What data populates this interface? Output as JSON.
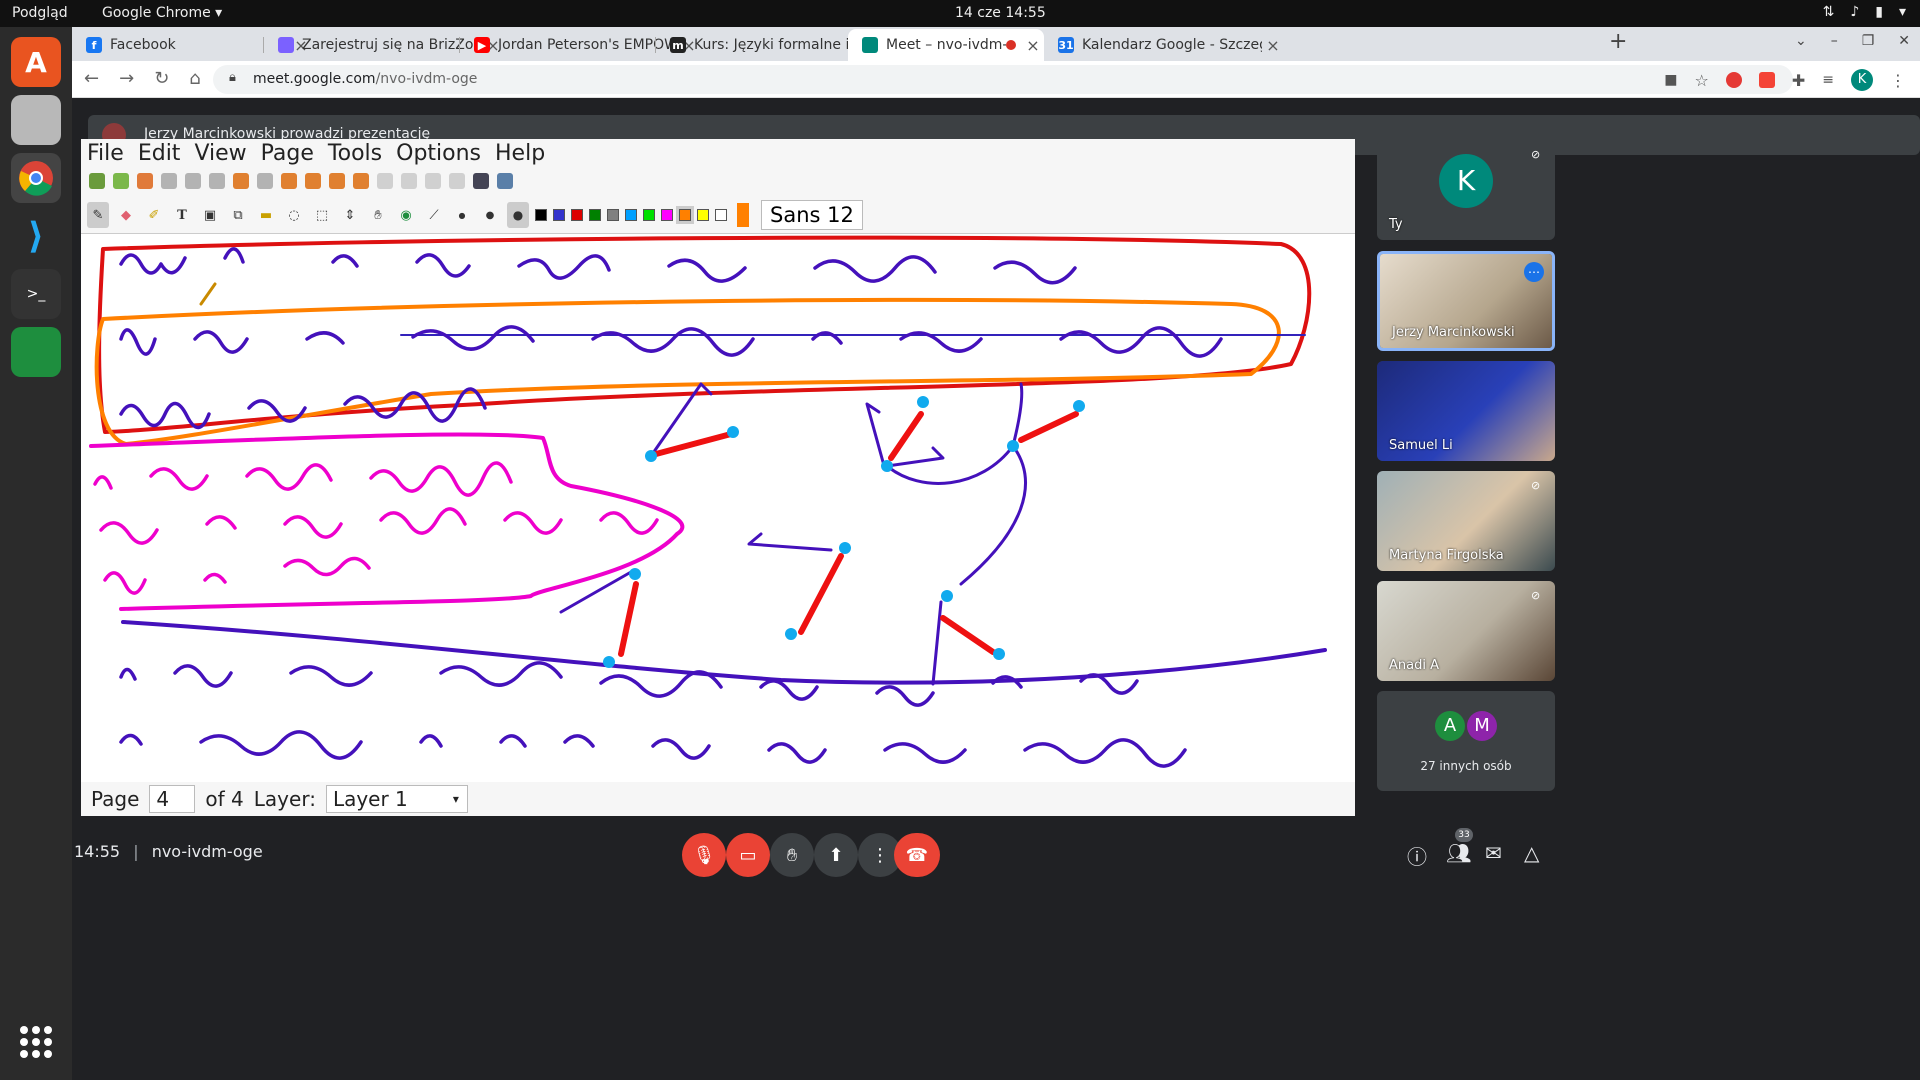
{
  "os": {
    "activities": "Podgląd",
    "app_name": "Google Chrome",
    "clock": "14 cze  14:55"
  },
  "browser": {
    "tabs": [
      {
        "title": "Facebook",
        "favicon_color": "#1877f2",
        "active": false
      },
      {
        "title": "Zarejestruj się na BrizZon",
        "favicon_color": "#7b61ff",
        "active": false
      },
      {
        "title": "Jordan Peterson's EMPOW",
        "favicon_color": "#ff0000",
        "active": false
      },
      {
        "title": "Kurs: Języki formalne i zło",
        "favicon_color": "#222222",
        "active": false
      },
      {
        "title": "Meet – nvo-ivdm-oge",
        "favicon_color": "#00897b",
        "active": true
      },
      {
        "title": "Kalendarz Google - Szczeg",
        "favicon_color": "#1a73e8",
        "active": false
      }
    ],
    "url_host": "meet.google.com",
    "url_path": "/nvo-ivdm-oge",
    "profile_initial": "K"
  },
  "meet": {
    "banner_text": "Jerzy Marcinkowski prowadzi prezentację",
    "meeting_code": "nvo-ivdm-oge",
    "time": "14:55",
    "separator": "|",
    "participants_count": "33",
    "others_label": "27 innych osób",
    "others_initials": [
      "A",
      "M"
    ],
    "tiles": [
      {
        "name": "Ty",
        "initial": "K",
        "type": "avatar"
      },
      {
        "name": "Jerzy Marcinkowski",
        "type": "video",
        "active": true
      },
      {
        "name": "Samuel Li",
        "type": "video"
      },
      {
        "name": "Martyna Firgolska",
        "type": "video"
      },
      {
        "name": "Anadi A",
        "type": "video"
      }
    ]
  },
  "xournal": {
    "menu": [
      "File",
      "Edit",
      "View",
      "Page",
      "Tools",
      "Options",
      "Help"
    ],
    "font": "Sans 12",
    "palette": [
      "#000000",
      "#3333cc",
      "#dd0000",
      "#008000",
      "#808080",
      "#00a0ff",
      "#00e000",
      "#ff00ff",
      "#ff8000",
      "#ffff00",
      "#ffffff"
    ],
    "current_color": "#ff8000",
    "page_label": "Page",
    "page_value": "4",
    "of_label": "of 4",
    "layer_label": "Layer:",
    "layer_value": "Layer 1"
  }
}
